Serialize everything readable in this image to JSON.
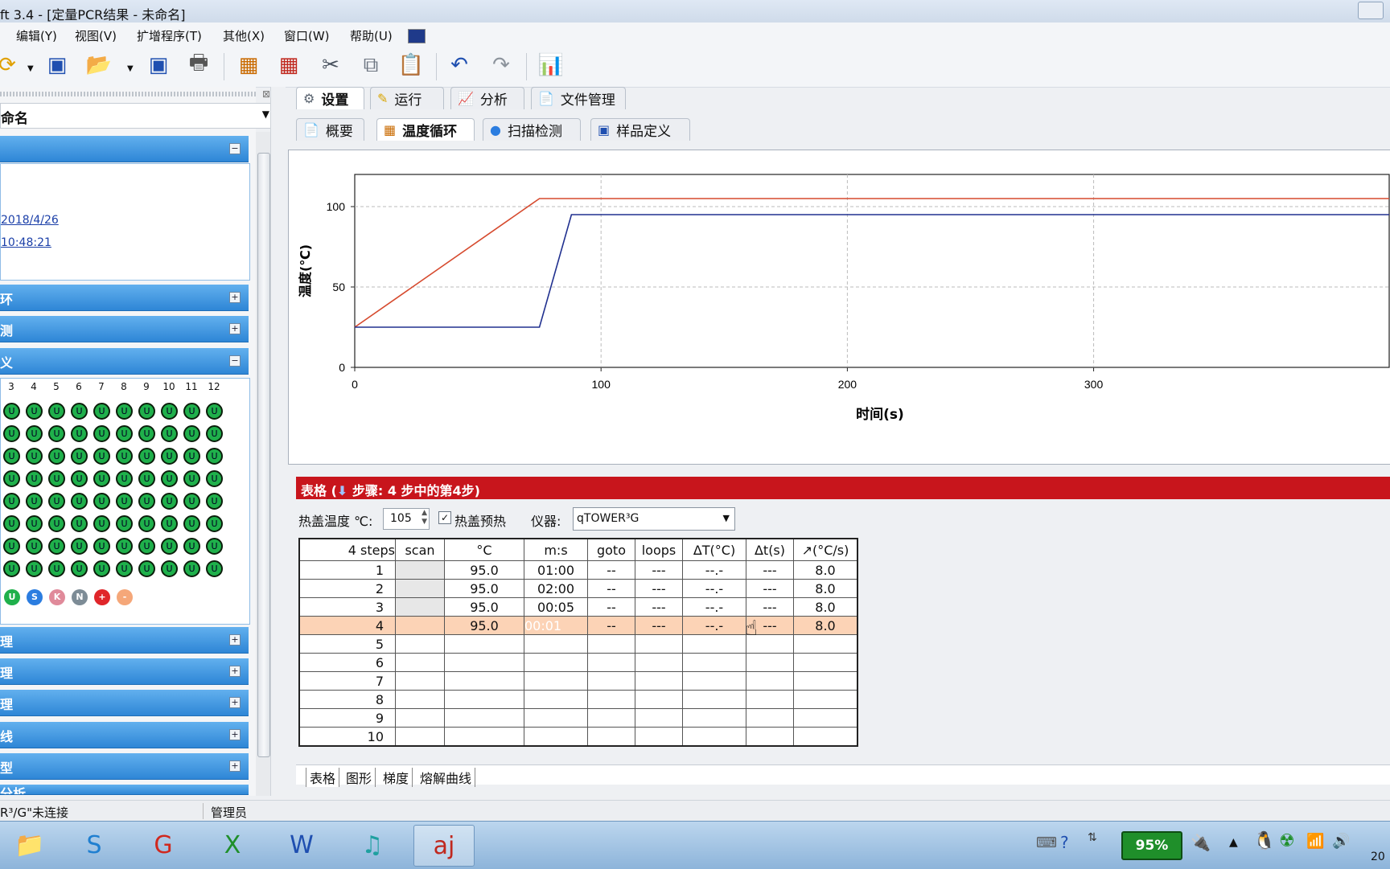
{
  "window": {
    "title": "ft 3.4 - [定量PCR结果 - 未命名]"
  },
  "menu": [
    "编辑(Y)",
    "视图(V)",
    "扩增程序(T)",
    "其他(X)",
    "窗口(W)",
    "帮助(U)"
  ],
  "left": {
    "combo": "命名",
    "date_link": "2018/4/26",
    "time_link": "10:48:21",
    "sections_top": [
      "环",
      "测",
      "义"
    ],
    "sections_bottom": [
      "理",
      "理",
      "理",
      "线",
      "型",
      "分析"
    ],
    "plate_columns": [
      "3",
      "4",
      "5",
      "6",
      "7",
      "8",
      "9",
      "10",
      "11",
      "12"
    ],
    "well_label": "U",
    "legend": [
      "U",
      "S",
      "K",
      "N",
      "+",
      "-"
    ]
  },
  "tabs_main": [
    "设置",
    "运行",
    "分析",
    "文件管理"
  ],
  "tabs_sub": [
    "概要",
    "温度循环",
    "扫描检测",
    "样品定义"
  ],
  "chart_data": {
    "type": "line",
    "ylabel": "温度(℃)",
    "xlabel": "时间(s)",
    "xlim": [
      0,
      420
    ],
    "ylim": [
      0,
      120
    ],
    "x_ticks": [
      "0",
      "100",
      "200",
      "300"
    ],
    "y_ticks": [
      "0",
      "50",
      "100"
    ],
    "series": [
      {
        "color": "#d64a2e",
        "x": [
          0,
          75,
          420
        ],
        "y": [
          25,
          105,
          105
        ]
      },
      {
        "color": "#20308f",
        "x": [
          0,
          75,
          88,
          420
        ],
        "y": [
          25,
          25,
          95,
          95
        ]
      }
    ],
    "grid": true
  },
  "table": {
    "header_prefix": "表格 (",
    "header_text": "步骤: 4 步中的第4步)",
    "lid_label": "热盖温度 ℃:",
    "lid_value": "105",
    "preheat_label": "热盖预热",
    "instrument_label": "仪器:",
    "instrument_value": "qTOWER³G",
    "columns": [
      "4 steps",
      "scan",
      "°C",
      "m:s",
      "goto",
      "loops",
      "ΔT(°C)",
      "Δt(s)",
      "↗(°C/s)"
    ],
    "rows": [
      [
        "1",
        "",
        "95.0",
        "01:00",
        "--",
        "---",
        "--.-",
        "---",
        "8.0"
      ],
      [
        "2",
        "",
        "95.0",
        "02:00",
        "--",
        "---",
        "--.-",
        "---",
        "8.0"
      ],
      [
        "3",
        "",
        "95.0",
        "00:05",
        "--",
        "---",
        "--.-",
        "---",
        "8.0"
      ],
      [
        "4",
        "",
        "95.0",
        "00:01",
        "--",
        "---",
        "--.-",
        "---",
        "8.0"
      ],
      [
        "5",
        "",
        "",
        "",
        "",
        "",
        "",
        "",
        ""
      ],
      [
        "6",
        "",
        "",
        "",
        "",
        "",
        "",
        "",
        ""
      ],
      [
        "7",
        "",
        "",
        "",
        "",
        "",
        "",
        "",
        ""
      ],
      [
        "8",
        "",
        "",
        "",
        "",
        "",
        "",
        "",
        ""
      ],
      [
        "9",
        "",
        "",
        "",
        "",
        "",
        "",
        "",
        ""
      ],
      [
        "10",
        "",
        "",
        "",
        "",
        "",
        "",
        "",
        ""
      ]
    ],
    "subtabs": [
      "表格",
      "图形",
      "梯度",
      "熔解曲线"
    ]
  },
  "status": {
    "connection": "R³/G\"未连接",
    "user": "管理员"
  },
  "taskbar": {
    "battery": "95%",
    "clock": "20"
  }
}
